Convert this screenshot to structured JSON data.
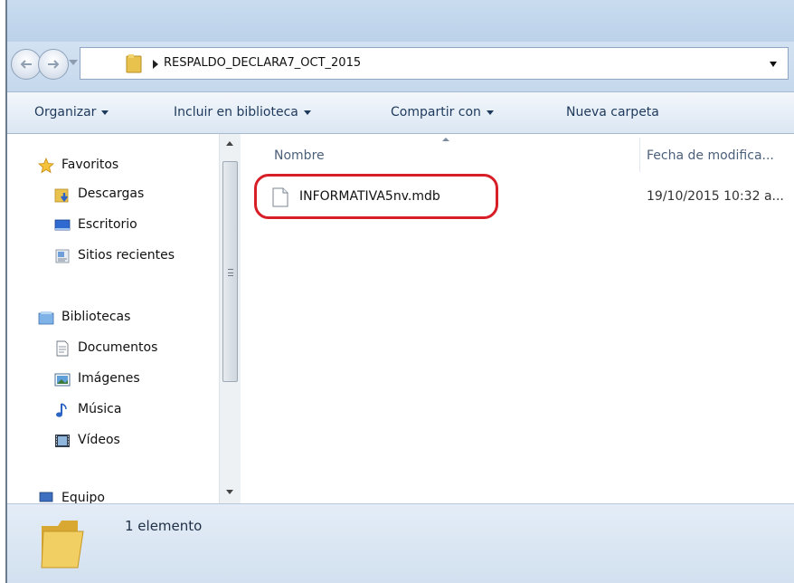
{
  "address": {
    "path": "RESPALDO_DECLARA7_OCT_2015"
  },
  "toolbar": {
    "organize_label": "Organizar",
    "library_label": "Incluir en biblioteca",
    "share_label": "Compartir con",
    "new_folder_label": "Nueva carpeta"
  },
  "nav": {
    "favorites_label": "Favoritos",
    "downloads_label": "Descargas",
    "desktop_label": "Escritorio",
    "recent_label": "Sitios recientes",
    "libraries_label": "Bibliotecas",
    "documents_label": "Documentos",
    "images_label": "Imágenes",
    "music_label": "Música",
    "videos_label": "Vídeos",
    "computer_label": "Equipo"
  },
  "columns": {
    "name": "Nombre",
    "date": "Fecha de modifica..."
  },
  "files": [
    {
      "name": "INFORMATIVA5nv.mdb",
      "date": "19/10/2015 10:32 a..."
    }
  ],
  "status": {
    "count": "1 elemento"
  },
  "colors": {
    "highlight": "#d81e26",
    "toolbar_text": "#1e395b",
    "folder": "#e8c24c"
  }
}
